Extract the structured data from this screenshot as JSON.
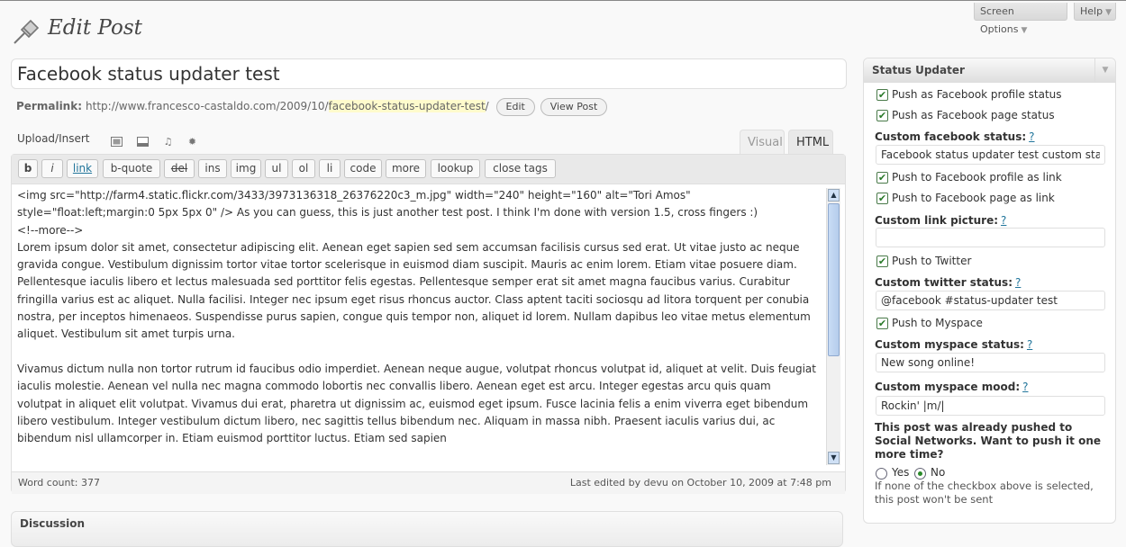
{
  "topbar": {
    "screen_options": "Screen Options",
    "help": "Help"
  },
  "page": {
    "title": "Edit Post"
  },
  "post": {
    "title": "Facebook status updater test",
    "permalink_label": "Permalink:",
    "permalink_base": "http://www.francesco-castaldo.com/2009/10/",
    "permalink_slug": "facebook-status-updater-test",
    "permalink_tail": "/",
    "edit_button": "Edit",
    "view_button": "View Post"
  },
  "editor": {
    "upload_insert": "Upload/Insert",
    "media_icons": [
      "image-icon",
      "video-icon",
      "audio-icon",
      "media-icon"
    ],
    "tab_visual": "Visual",
    "tab_html": "HTML",
    "quicktags": [
      "b",
      "i",
      "link",
      "b-quote",
      "del",
      "ins",
      "img",
      "ul",
      "ol",
      "li",
      "code",
      "more",
      "lookup",
      "close tags"
    ],
    "content": [
      "<img src=\"http://farm4.static.flickr.com/3433/3973136318_26376220c3_m.jpg\" width=\"240\" height=\"160\" alt=\"Tori Amos\" style=\"float:left;margin:0 5px 5px 0\" /> As you can guess, this is just another test post. I think I'm done with version 1.5, cross fingers :)",
      "<!--more-->",
      "Lorem ipsum dolor sit amet, consectetur adipiscing elit. Aenean eget sapien sed sem accumsan facilisis cursus sed erat. Ut vitae justo ac neque gravida congue. Vestibulum dignissim tortor vitae tortor scelerisque in euismod diam suscipit. Mauris ac enim lorem. Etiam vitae posuere diam. Pellentesque iaculis libero et lectus malesuada sed porttitor felis egestas. Pellentesque semper erat sit amet magna faucibus varius. Curabitur fringilla varius est ac aliquet. Nulla facilisi. Integer nec ipsum eget risus rhoncus auctor. Class aptent taciti sociosqu ad litora torquent per conubia nostra, per inceptos himenaeos. Suspendisse purus sapien, congue quis tempor non, aliquet id lorem. Nullam dapibus leo vitae metus elementum aliquet. Vestibulum sit amet turpis urna.",
      "",
      "Vivamus dictum nulla non tortor rutrum id faucibus odio imperdiet. Aenean neque augue, volutpat rhoncus volutpat id, aliquet at velit. Duis feugiat iaculis molestie. Aenean vel nulla nec magna commodo lobortis nec convallis libero. Aenean eget est arcu. Integer egestas arcu quis quam volutpat in aliquet elit volutpat. Vivamus dui erat, pharetra ut dignissim ac, euismod eget ipsum. Fusce lacinia felis a enim viverra eget bibendum libero vestibulum. Integer vestibulum dictum libero, nec sagittis tellus bibendum nec. Aliquam in massa nibh. Praesent iaculis varius dui, ac bibendum nisl ullamcorper in. Etiam euismod porttitor luctus. Etiam sed sapien"
    ],
    "word_count": "Word count: 377",
    "last_edited": "Last edited by devu on October 10, 2009 at 7:48 pm"
  },
  "discussion": {
    "title": "Discussion"
  },
  "status_updater": {
    "title": "Status Updater",
    "push_fb_profile_status": "Push as Facebook profile status",
    "push_fb_page_status": "Push as Facebook page status",
    "custom_fb_status_label": "Custom facebook status:",
    "custom_fb_status_value": "Facebook status updater test custom status",
    "push_fb_profile_link": "Push to Facebook profile as link",
    "push_fb_page_link": "Push to Facebook page as link",
    "custom_link_picture_label": "Custom link picture:",
    "custom_link_picture_value": "",
    "push_twitter": "Push to Twitter",
    "custom_twitter_label": "Custom twitter status:",
    "custom_twitter_value": "@facebook #status-updater test",
    "push_myspace": "Push to Myspace",
    "custom_myspace_status_label": "Custom myspace status:",
    "custom_myspace_status_value": "New song online!",
    "custom_myspace_mood_label": "Custom myspace mood:",
    "custom_myspace_mood_value": "Rockin' |m/|",
    "help_mark": "?",
    "pushed_question": "This post was already pushed to Social Networks. Want to push it one more time?",
    "yes_label": "Yes",
    "no_label": "No",
    "selected": "No",
    "footnote": "If none of the checkbox above is selected, this post won't be sent"
  }
}
